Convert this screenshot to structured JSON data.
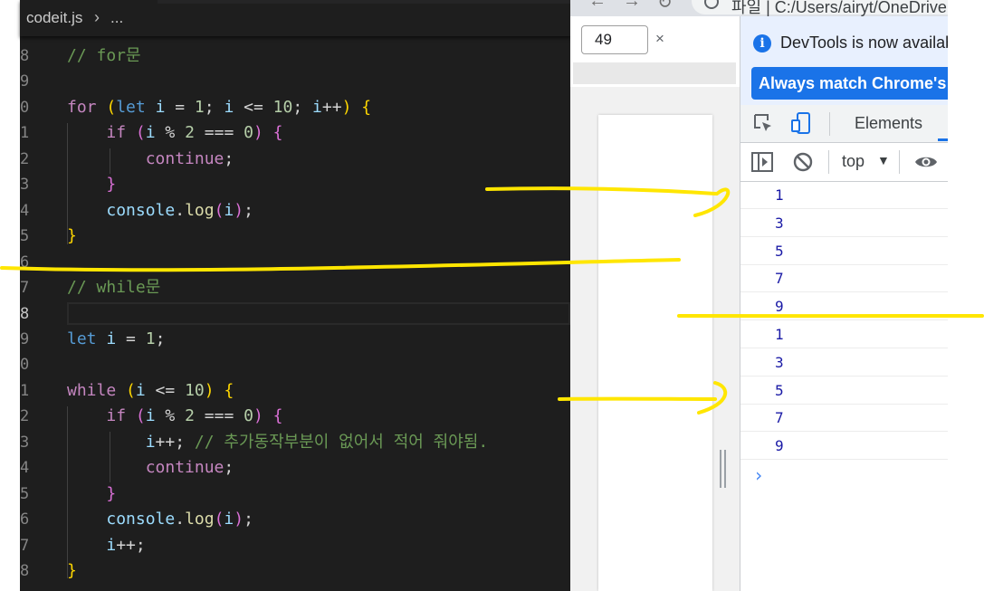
{
  "editor": {
    "breadcrumb": {
      "file": "codeit.js",
      "separator": "›",
      "more": "..."
    },
    "lines": [
      {
        "num": "8",
        "tokens": [
          [
            "c-cmt",
            "// for문"
          ]
        ]
      },
      {
        "num": "9",
        "tokens": []
      },
      {
        "num": "0",
        "tokens": [
          [
            "c-kw",
            "for"
          ],
          [
            "c-op",
            " "
          ],
          [
            "c-p1",
            "("
          ],
          [
            "c-kwb",
            "let"
          ],
          [
            "c-op",
            " "
          ],
          [
            "c-var",
            "i"
          ],
          [
            "c-op",
            " = "
          ],
          [
            "c-num",
            "1"
          ],
          [
            "c-op",
            "; "
          ],
          [
            "c-var",
            "i"
          ],
          [
            "c-op",
            " <= "
          ],
          [
            "c-num",
            "10"
          ],
          [
            "c-op",
            "; "
          ],
          [
            "c-var",
            "i"
          ],
          [
            "c-op",
            "++"
          ],
          [
            "c-p1",
            ")"
          ],
          [
            "c-op",
            " "
          ],
          [
            "c-p1",
            "{"
          ]
        ]
      },
      {
        "num": "1",
        "tokens": [
          [
            "c-op",
            "    "
          ],
          [
            "c-kw",
            "if"
          ],
          [
            "c-op",
            " "
          ],
          [
            "c-p2",
            "("
          ],
          [
            "c-var",
            "i"
          ],
          [
            "c-op",
            " % "
          ],
          [
            "c-num",
            "2"
          ],
          [
            "c-op",
            " === "
          ],
          [
            "c-num",
            "0"
          ],
          [
            "c-p2",
            ")"
          ],
          [
            "c-op",
            " "
          ],
          [
            "c-p2",
            "{"
          ]
        ]
      },
      {
        "num": "2",
        "tokens": [
          [
            "c-op",
            "        "
          ],
          [
            "c-kw",
            "continue"
          ],
          [
            "c-op",
            ";"
          ]
        ]
      },
      {
        "num": "3",
        "tokens": [
          [
            "c-op",
            "    "
          ],
          [
            "c-p2",
            "}"
          ]
        ]
      },
      {
        "num": "4",
        "tokens": [
          [
            "c-op",
            "    "
          ],
          [
            "c-var",
            "console"
          ],
          [
            "c-op",
            "."
          ],
          [
            "c-fn",
            "log"
          ],
          [
            "c-p2",
            "("
          ],
          [
            "c-var",
            "i"
          ],
          [
            "c-p2",
            ")"
          ],
          [
            "c-op",
            ";"
          ]
        ]
      },
      {
        "num": "5",
        "tokens": [
          [
            "c-p1",
            "}"
          ]
        ]
      },
      {
        "num": "6",
        "tokens": []
      },
      {
        "num": "7",
        "tokens": [
          [
            "c-cmt",
            "// while문"
          ]
        ]
      },
      {
        "num": "8",
        "tokens": [],
        "active": true
      },
      {
        "num": "9",
        "tokens": [
          [
            "c-kwb",
            "let"
          ],
          [
            "c-op",
            " "
          ],
          [
            "c-var",
            "i"
          ],
          [
            "c-op",
            " = "
          ],
          [
            "c-num",
            "1"
          ],
          [
            "c-op",
            ";"
          ]
        ]
      },
      {
        "num": "0",
        "tokens": []
      },
      {
        "num": "1",
        "tokens": [
          [
            "c-kw",
            "while"
          ],
          [
            "c-op",
            " "
          ],
          [
            "c-p1",
            "("
          ],
          [
            "c-var",
            "i"
          ],
          [
            "c-op",
            " <= "
          ],
          [
            "c-num",
            "10"
          ],
          [
            "c-p1",
            ")"
          ],
          [
            "c-op",
            " "
          ],
          [
            "c-p1",
            "{"
          ]
        ]
      },
      {
        "num": "2",
        "tokens": [
          [
            "c-op",
            "    "
          ],
          [
            "c-kw",
            "if"
          ],
          [
            "c-op",
            " "
          ],
          [
            "c-p2",
            "("
          ],
          [
            "c-var",
            "i"
          ],
          [
            "c-op",
            " % "
          ],
          [
            "c-num",
            "2"
          ],
          [
            "c-op",
            " === "
          ],
          [
            "c-num",
            "0"
          ],
          [
            "c-p2",
            ")"
          ],
          [
            "c-op",
            " "
          ],
          [
            "c-p2",
            "{"
          ]
        ]
      },
      {
        "num": "3",
        "tokens": [
          [
            "c-op",
            "        "
          ],
          [
            "c-var",
            "i"
          ],
          [
            "c-op",
            "++; "
          ],
          [
            "c-cmt",
            "// 추가동작부분이 없어서 적어 줘야됨."
          ]
        ]
      },
      {
        "num": "4",
        "tokens": [
          [
            "c-op",
            "        "
          ],
          [
            "c-kw",
            "continue"
          ],
          [
            "c-op",
            ";"
          ]
        ]
      },
      {
        "num": "5",
        "tokens": [
          [
            "c-op",
            "    "
          ],
          [
            "c-p2",
            "}"
          ]
        ]
      },
      {
        "num": "6",
        "tokens": [
          [
            "c-op",
            "    "
          ],
          [
            "c-var",
            "console"
          ],
          [
            "c-op",
            "."
          ],
          [
            "c-fn",
            "log"
          ],
          [
            "c-p2",
            "("
          ],
          [
            "c-var",
            "i"
          ],
          [
            "c-p2",
            ")"
          ],
          [
            "c-op",
            ";"
          ]
        ]
      },
      {
        "num": "7",
        "tokens": [
          [
            "c-op",
            "    "
          ],
          [
            "c-var",
            "i"
          ],
          [
            "c-op",
            "++;"
          ]
        ]
      },
      {
        "num": "8",
        "tokens": [
          [
            "c-p1",
            "}"
          ]
        ]
      }
    ]
  },
  "browser": {
    "url": "파일 | C:/Users/airyt/OneDrive",
    "zoom_value": "49",
    "zoom_close": "×"
  },
  "devtools": {
    "notice_text": "DevTools is now available in Korean",
    "notice_button": "Always match Chrome's language",
    "tab_elements": "Elements",
    "context_label": "top",
    "context_arrow": "▼",
    "console_output": [
      "1",
      "3",
      "5",
      "7",
      "9",
      "1",
      "3",
      "5",
      "7",
      "9"
    ],
    "prompt_symbol": "›"
  },
  "annotation_color": "#ffe600"
}
